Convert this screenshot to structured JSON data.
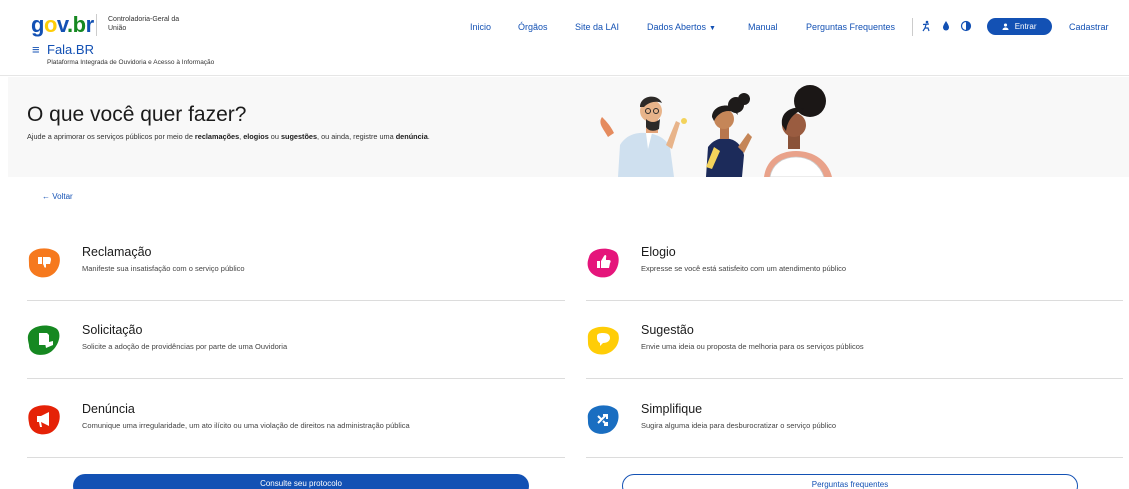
{
  "header": {
    "logo": {
      "g": "g",
      "o": "o",
      "v": "v",
      "dot": ".",
      "b": "b",
      "r": "r"
    },
    "org_name": "Controladoria-Geral da União",
    "menu_icon": "≡",
    "app_name": "Fala.BR",
    "app_subtitle": "Plataforma Integrada de Ouvidoria e Acesso à Informação",
    "nav": [
      "Inicio",
      "Órgãos",
      "Site da LAI",
      "Dados Abertos",
      "Manual",
      "Perguntas Frequentes"
    ],
    "nav_caret": "▼",
    "tools": [
      "accessibility-icon",
      "color-drop-icon",
      "contrast-icon"
    ],
    "login_label": "Entrar",
    "register_label": "Cadastrar"
  },
  "hero": {
    "title": "O que você quer fazer?",
    "desc_parts": [
      "Ajude a aprimorar os serviços públicos por meio de ",
      "reclamações",
      ", ",
      "elogios",
      " ou ",
      "sugestões",
      ", ou ainda, registre uma ",
      "denúncia",
      "."
    ]
  },
  "back_label": "Voltar",
  "back_arrow": "←",
  "options": [
    {
      "title": "Reclamação",
      "desc": "Manifeste sua insatisfação com o serviço público",
      "icon": "thumbs-down-icon",
      "color": "#f6791e"
    },
    {
      "title": "Elogio",
      "desc": "Expresse se você está satisfeito com um atendimento público",
      "icon": "thumbs-up-icon",
      "color": "#e5157b"
    },
    {
      "title": "Solicitação",
      "desc": "Solicite a adoção de providências por parte de uma Ouvidoria",
      "icon": "document-hand-icon",
      "color": "#168821"
    },
    {
      "title": "Sugestão",
      "desc": "Envie uma ideia ou proposta de melhoria para os serviços públicos",
      "icon": "speech-bubble-icon",
      "color": "#ffcd07"
    },
    {
      "title": "Denúncia",
      "desc": "Comunique uma irregularidade, um ato ilícito ou uma violação de direitos na administração pública",
      "icon": "megaphone-icon",
      "color": "#e52207"
    },
    {
      "title": "Simplifique",
      "desc": "Sugira alguma ideia para desburocratizar o serviço público",
      "icon": "simplify-arrows-icon",
      "color": "#1a6ec1"
    }
  ],
  "buttons": {
    "protocolo": "Consulte seu protocolo",
    "faq": "Perguntas frequentes"
  }
}
